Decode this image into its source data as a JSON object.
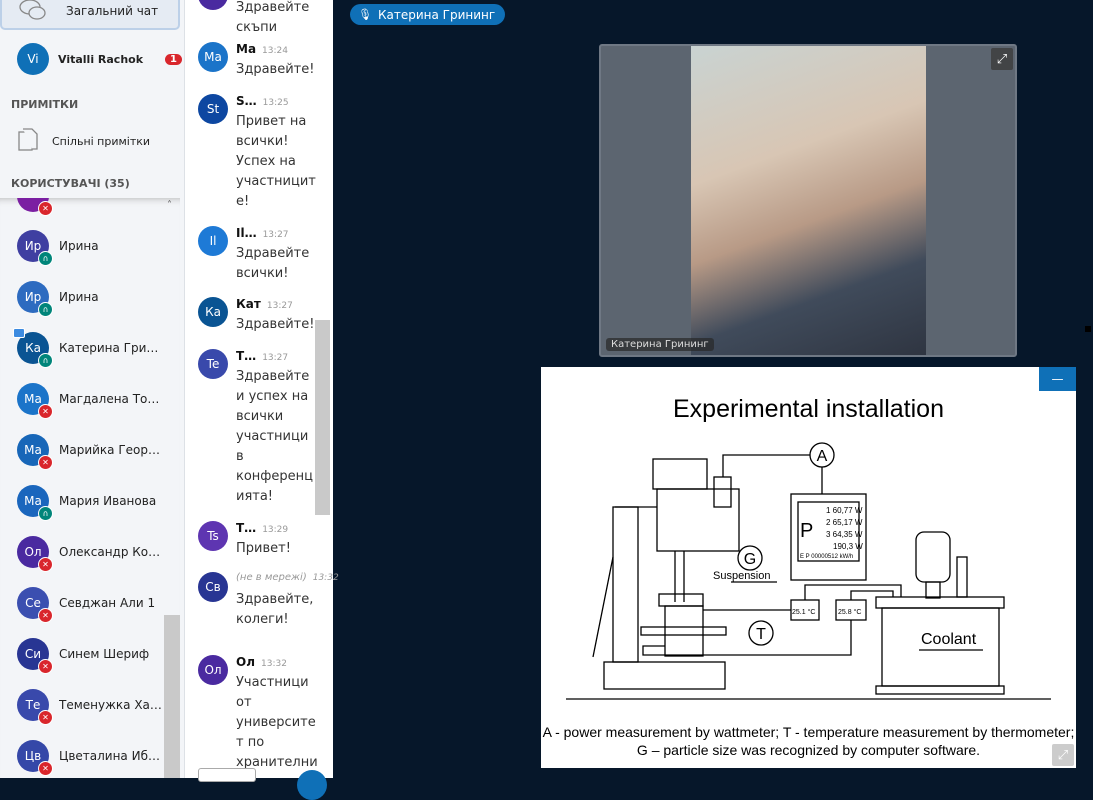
{
  "left_panel": {
    "public_chat": "Загальний чат",
    "private_chat": {
      "initials": "Vi",
      "name": "Vitalli Rachok",
      "unread": "1"
    },
    "notes_header": "ПРИМІТКИ",
    "shared_notes": "Спільні примітки",
    "users_header": "КОРИСТУВАЧІ (35)",
    "users": [
      {
        "initials": "Ир",
        "name": "Ирина",
        "status": "listen",
        "color": "#3f3fa1"
      },
      {
        "initials": "Ир",
        "name": "Ирина",
        "status": "listen",
        "color": "#2d6bc0"
      },
      {
        "initials": "Ка",
        "name": "Катерина Грининг",
        "status": "listen",
        "color": "#0a5493",
        "presenter": true
      },
      {
        "initials": "Ма",
        "name": "Магдалена Тодорова",
        "status": "muted",
        "color": "#1b74c9"
      },
      {
        "initials": "Ма",
        "name": "Марийка Георгиева",
        "status": "muted",
        "color": "#1766b8"
      },
      {
        "initials": "Ма",
        "name": "Мария Иванова",
        "status": "listen",
        "color": "#1a66bd"
      },
      {
        "initials": "Ол",
        "name": "Олександр Козлов",
        "status": "muted",
        "color": "#4a2aa0"
      },
      {
        "initials": "Се",
        "name": "Севджан Али 1",
        "status": "muted",
        "color": "#3b4fb0"
      },
      {
        "initials": "Си",
        "name": "Синем Шериф",
        "status": "muted",
        "color": "#283593"
      },
      {
        "initials": "Те",
        "name": "Теменужка Харизанова",
        "status": "muted",
        "color": "#3949ab"
      },
      {
        "initials": "Цв",
        "name": "Цветалина Ибрямова",
        "status": "muted",
        "color": "#3548a8"
      }
    ]
  },
  "chat": {
    "messages": [
      {
        "initials": "",
        "name": "",
        "time": "",
        "text": "Здравейте скъпи",
        "color": "#4a2aa0"
      },
      {
        "initials": "Ма",
        "name": "Ма",
        "time": "13:24",
        "text": "Здравейте!",
        "color": "#1b74c9"
      },
      {
        "initials": "St",
        "name": "S…",
        "time": "13:25",
        "text": "Привет на всички! Успех на участниците!",
        "color": "#0d47a1"
      },
      {
        "initials": "Il",
        "name": "Il…",
        "time": "13:27",
        "text": "Здравейте всички!",
        "color": "#1e7ad6"
      },
      {
        "initials": "Ка",
        "name": "Кат",
        "time": "13:27",
        "text": "Здравейте!",
        "color": "#0a5493"
      },
      {
        "initials": "Te",
        "name": "T…",
        "time": "13:27",
        "text": "Здравейте и успех на всички участници в конференцията!",
        "color": "#3949ab"
      },
      {
        "initials": "Ts",
        "name": "T…",
        "time": "13:29",
        "text": "Привет!",
        "color": "#5e35b1"
      },
      {
        "initials": "Св",
        "name": "(не в мережі)",
        "time": "13:32",
        "text": "Здравейте, колеги!",
        "color": "#283593"
      },
      {
        "initials": "Ол",
        "name": "Ол",
        "time": "13:32",
        "text": "Участници от университет по хранителни",
        "color": "#4a2aa0"
      }
    ]
  },
  "main": {
    "speaker": "Катерина Грининг",
    "video_label": "Катерина Грининг",
    "slide": {
      "title": "Experimental installation",
      "labels": {
        "A": "A",
        "G": "G",
        "T": "T",
        "suspension": "Suspension",
        "coolant": "Coolant",
        "P": "P"
      },
      "meter": [
        "1 60,77 W",
        "2 65,17 W",
        "3 64,35 W",
        "190,3 W",
        "E P 00000512 kW/h"
      ],
      "thermo1": "25.1 °C",
      "thermo2": "25.8 °C",
      "caption": "A - power measurement by wattmeter; T - temperature measurement by thermometer; G – particle size was recognized by computer software."
    }
  }
}
